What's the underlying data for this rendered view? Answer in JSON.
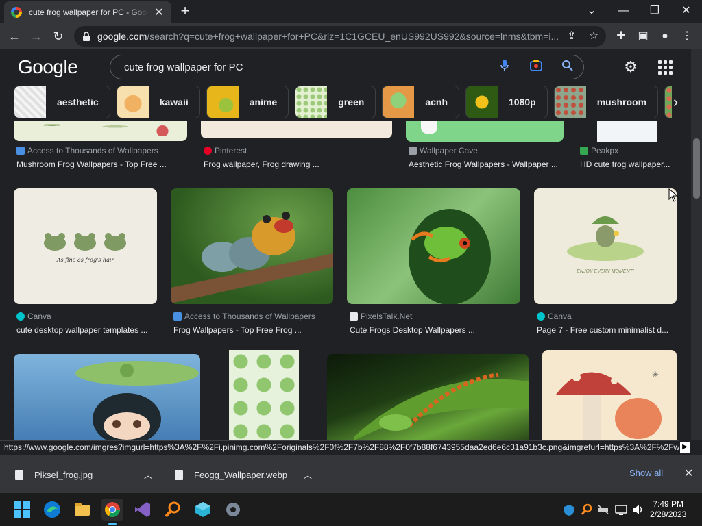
{
  "browser": {
    "tab_title": "cute frog wallpaper for PC - Google Search",
    "tab_close": "✕",
    "new_tab": "+",
    "url_host": "google.com",
    "url_path": "/search?q=cute+frog+wallpaper+for+PC&rlz=1C1GCEU_enUS992US992&source=lnms&tbm=i...",
    "window_controls": {
      "chevron": "⌄",
      "minimize": "—",
      "restore": "❐",
      "close": "✕"
    }
  },
  "google": {
    "logo": "Google",
    "query": "cute frog wallpaper for PC",
    "chips": [
      {
        "label": "aesthetic",
        "color": "#ececec"
      },
      {
        "label": "kawaii",
        "color": "#f6c47a"
      },
      {
        "label": "anime",
        "color": "#e0b11f"
      },
      {
        "label": "green",
        "color": "#bfe0a0"
      },
      {
        "label": "acnh",
        "color": "#e49d4b"
      },
      {
        "label": "1080p",
        "color": "#3f6b1a"
      },
      {
        "label": "mushroom",
        "color": "#8da68e"
      },
      {
        "label": "",
        "color": "#6fa65a"
      }
    ],
    "row1": [
      {
        "source": "Access to Thousands of Wallpapers",
        "title": "Mushroom Frog Wallpapers - Top Free ...",
        "fav_color": "#4a90e2"
      },
      {
        "source": "Pinterest",
        "title": "Frog wallpaper, Frog drawing ...",
        "fav_color": "#e60023"
      },
      {
        "source": "Wallpaper Cave",
        "title": "Aesthetic Frog Wallpapers - Wallpaper ...",
        "fav_color": "#9aa0a6"
      },
      {
        "source": "Peakpx",
        "title": "HD cute frog wallpaper...",
        "fav_color": "#34a853"
      }
    ],
    "row2": [
      {
        "source": "Canva",
        "title": "cute desktop wallpaper templates ...",
        "fav_color": "#00c4cc",
        "caption": "As fine as frog's hair"
      },
      {
        "source": "Access to Thousands of Wallpapers",
        "title": "Frog Wallpapers - Top Free Frog ...",
        "fav_color": "#4a90e2"
      },
      {
        "source": "PixelsTalk.Net",
        "title": "Cute Frogs Desktop Wallpapers ...",
        "fav_color": "#e8eaed"
      },
      {
        "source": "Canva",
        "title": "Page 7 - Free custom minimalist d...",
        "fav_color": "#00c4cc",
        "caption": "ENJOY EVERY MOMENT!"
      }
    ]
  },
  "status_url": "https://www.google.com/imgres?imgurl=https%3A%2F%2Fi.pinimg.com%2Foriginals%2F0f%2F7b%2F88%2F0f7b88f6743955daa2ed6e6c31a91b3c.png&imgrefurl=https%3A%2F%2Fw...",
  "downloads": {
    "items": [
      "Piksel_frog.jpg",
      "Feogg_Wallpaper.webp"
    ],
    "show_all": "Show all",
    "close": "✕"
  },
  "taskbar": {
    "time": "7:49 PM",
    "date": "2/28/2023"
  }
}
